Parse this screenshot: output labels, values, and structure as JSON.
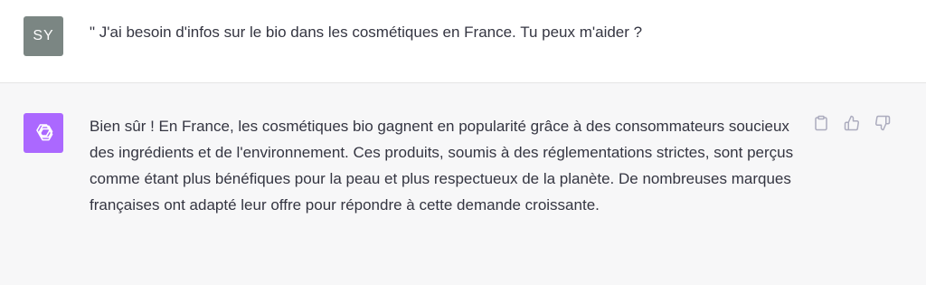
{
  "user": {
    "avatar_initials": "SY",
    "avatar_color": "#7b8683",
    "message": "\" J'ai besoin d'infos sur le bio dans les cosmétiques en France. Tu peux m'aider ?"
  },
  "assistant": {
    "avatar_icon": "openai-logo-icon",
    "avatar_color": "#ab68ff",
    "message": "Bien sûr ! En France, les cosmétiques bio gagnent en popularité grâce à des consommateurs soucieux des ingrédients et de l'environnement. Ces produits, soumis à des réglementations strictes, sont perçus comme étant plus bénéfiques pour la peau et plus respectueux de la planète. De nombreuses marques françaises ont adapté leur offre pour répondre à cette demande croissante.",
    "actions": [
      "clipboard-icon",
      "thumbs-up-icon",
      "thumbs-down-icon"
    ]
  }
}
